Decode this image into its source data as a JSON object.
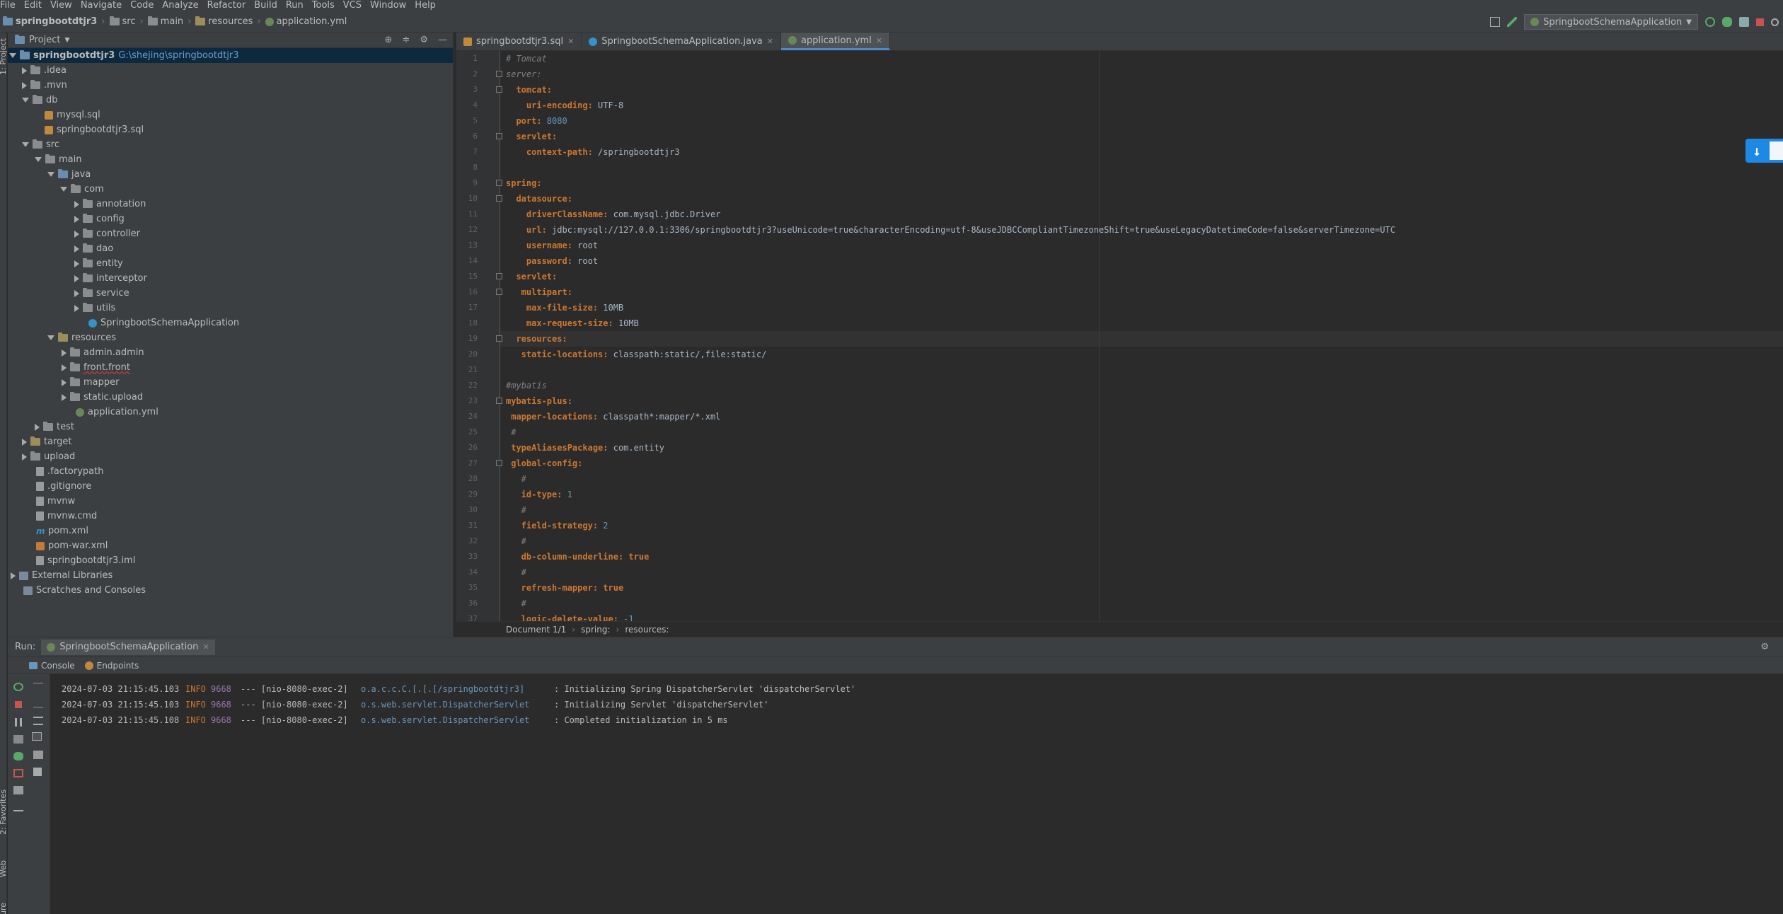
{
  "menu": [
    "File",
    "Edit",
    "View",
    "Navigate",
    "Code",
    "Analyze",
    "Refactor",
    "Build",
    "Run",
    "Tools",
    "VCS",
    "Window",
    "Help"
  ],
  "breadcrumb": [
    "springbootdtjr3",
    "src",
    "main",
    "resources",
    "application.yml"
  ],
  "run_config": "SpringbootSchemaApplication",
  "project": {
    "header": "Project",
    "root_name": "springbootdtjr3",
    "root_path": "G:\\shejing\\springbootdtjr3",
    "items": [
      ".idea",
      ".mvn",
      "db",
      "mysql.sql",
      "springbootdtjr3.sql",
      "src",
      "main",
      "java",
      "com",
      "annotation",
      "config",
      "controller",
      "dao",
      "entity",
      "interceptor",
      "service",
      "utils",
      "SpringbootSchemaApplication",
      "resources",
      "admin.admin",
      "front.front",
      "mapper",
      "static.upload",
      "application.yml",
      "test",
      "target",
      "upload",
      ".factorypath",
      ".gitignore",
      "mvnw",
      "mvnw.cmd",
      "pom.xml",
      "pom-war.xml",
      "springbootdtjr3.iml",
      "External Libraries",
      "Scratches and Consoles"
    ]
  },
  "left_strip": {
    "project": "1: Project",
    "favorites": "2: Favorites",
    "web": "Web",
    "structure": "Structure"
  },
  "editor_tabs": [
    "springbootdtjr3.sql",
    "SpringbootSchemaApplication.java",
    "application.yml"
  ],
  "code": [
    {
      "n": "1",
      "t": "# Tomcat"
    },
    {
      "n": "2",
      "t": "server:"
    },
    {
      "n": "3",
      "k": "  tomcat:",
      "v": ""
    },
    {
      "n": "4",
      "k": "    uri-encoding:",
      "v": " UTF-8"
    },
    {
      "n": "5",
      "k": "  port:",
      "num": " 8080"
    },
    {
      "n": "6",
      "k": "  servlet:",
      "v": ""
    },
    {
      "n": "7",
      "k": "    context-path:",
      "v": " /springbootdtjr3"
    },
    {
      "n": "8",
      "t": ""
    },
    {
      "n": "9",
      "k": "spring:",
      "v": ""
    },
    {
      "n": "10",
      "k": "  datasource:",
      "v": ""
    },
    {
      "n": "11",
      "k": "    driverClassName:",
      "v": " com.mysql.jdbc.Driver"
    },
    {
      "n": "12",
      "k": "    url:",
      "v": " jdbc:mysql://127.0.0.1:3306/springbootdtjr3?useUnicode=true&characterEncoding=utf-8&useJDBCCompliantTimezoneShift=true&useLegacyDatetimeCode=false&serverTimezone=UTC"
    },
    {
      "n": "13",
      "k": "    username:",
      "v": " root"
    },
    {
      "n": "14",
      "k": "    password:",
      "v": " root"
    },
    {
      "n": "15",
      "k": "  servlet:",
      "v": ""
    },
    {
      "n": "16",
      "k": "   multipart:",
      "v": ""
    },
    {
      "n": "17",
      "k": "    max-file-size:",
      "v": " 10MB"
    },
    {
      "n": "18",
      "k": "    max-request-size:",
      "v": " 10MB"
    },
    {
      "n": "19",
      "k": "  resources:",
      "v": ""
    },
    {
      "n": "20",
      "k": "   static-locations:",
      "v": " classpath:static/,file:static/"
    },
    {
      "n": "21",
      "t": ""
    },
    {
      "n": "22",
      "t": "#mybatis"
    },
    {
      "n": "23",
      "k": "mybatis-plus:",
      "v": ""
    },
    {
      "n": "24",
      "k": " mapper-locations:",
      "v": " classpath*:mapper/*.xml"
    },
    {
      "n": "25",
      "t": " #"
    },
    {
      "n": "26",
      "k": " typeAliasesPackage:",
      "v": " com.entity"
    },
    {
      "n": "27",
      "k": " global-config:",
      "v": ""
    },
    {
      "n": "28",
      "t": "   #"
    },
    {
      "n": "29",
      "k": "   id-type:",
      "num": " 1"
    },
    {
      "n": "30",
      "t": "   #"
    },
    {
      "n": "31",
      "k": "   field-strategy:",
      "num": " 2"
    },
    {
      "n": "32",
      "t": "   #"
    },
    {
      "n": "33",
      "k": "   db-column-underline:",
      "kv": " true"
    },
    {
      "n": "34",
      "t": "   #"
    },
    {
      "n": "35",
      "k": "   refresh-mapper:",
      "kv": " true"
    },
    {
      "n": "36",
      "t": "   #"
    },
    {
      "n": "37",
      "k": "   logic-delete-value:",
      "num": " -1"
    }
  ],
  "editor_breadcrumb": [
    "Document 1/1",
    "spring:",
    "resources:"
  ],
  "run": {
    "label": "Run:",
    "tab": "SpringbootSchemaApplication",
    "subtabs": [
      "Console",
      "Endpoints"
    ],
    "log": [
      {
        "ts": "2024-07-03 21:15:45.103",
        "lvl": "INFO",
        "pid": "9668",
        "thread": "--- [nio-8080-exec-2]",
        "cls": "o.a.c.c.C.[.[.[/springbootdtjr3]",
        "msg": ": Initializing Spring DispatcherServlet 'dispatcherServlet'"
      },
      {
        "ts": "2024-07-03 21:15:45.103",
        "lvl": "INFO",
        "pid": "9668",
        "thread": "--- [nio-8080-exec-2]",
        "cls": "o.s.web.servlet.DispatcherServlet",
        "msg": ": Initializing Servlet 'dispatcherServlet'"
      },
      {
        "ts": "2024-07-03 21:15:45.108",
        "lvl": "INFO",
        "pid": "9668",
        "thread": "--- [nio-8080-exec-2]",
        "cls": "o.s.web.servlet.DispatcherServlet",
        "msg": ": Completed initialization in 5 ms"
      }
    ]
  },
  "colors": {
    "keyword": "#cc7832",
    "string": "#a9b7c6",
    "number": "#6897bb",
    "comment": "#808080",
    "accent": "#1e88e5"
  }
}
